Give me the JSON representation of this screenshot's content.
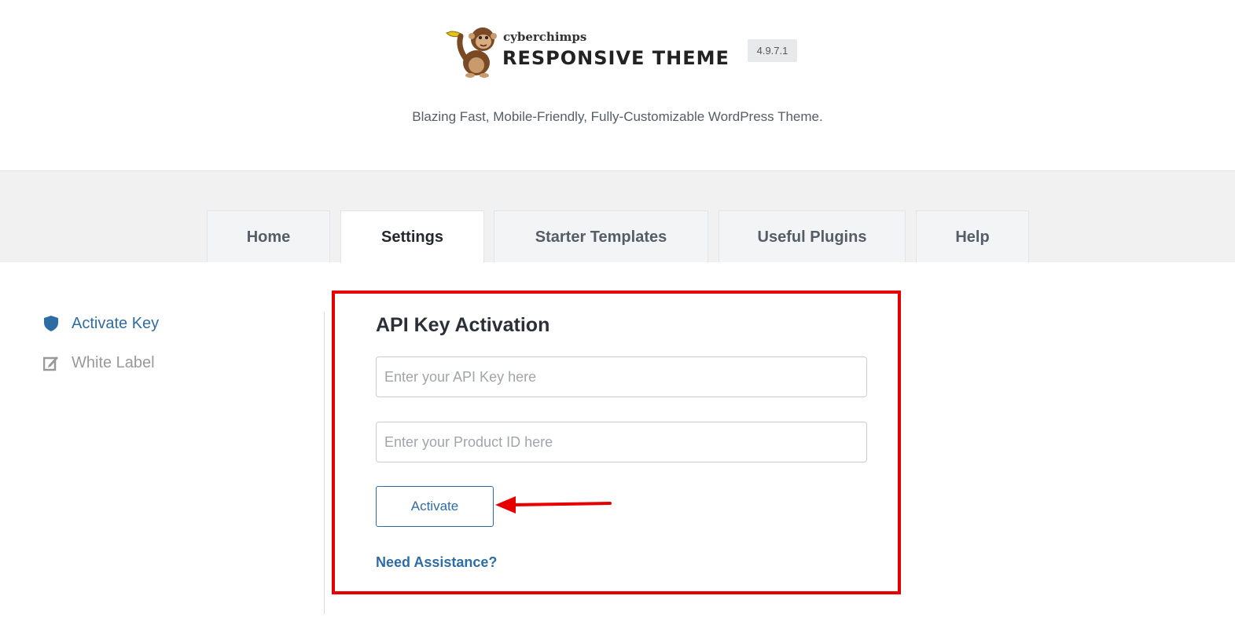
{
  "header": {
    "brand_small": "cyberchimps",
    "brand_large": "RESPONSIVE THEME",
    "version": "4.9.7.1",
    "tagline": "Blazing Fast, Mobile-Friendly, Fully-Customizable WordPress Theme."
  },
  "tabs": [
    {
      "label": "Home",
      "active": false
    },
    {
      "label": "Settings",
      "active": true
    },
    {
      "label": "Starter Templates",
      "active": false
    },
    {
      "label": "Useful Plugins",
      "active": false
    },
    {
      "label": "Help",
      "active": false
    }
  ],
  "sidebar": {
    "items": [
      {
        "label": "Activate Key",
        "icon": "shield-icon",
        "active": true
      },
      {
        "label": "White Label",
        "icon": "edit-icon",
        "active": false
      }
    ]
  },
  "panel": {
    "title": "API Key Activation",
    "api_key_placeholder": "Enter your API Key here",
    "api_key_value": "",
    "product_id_placeholder": "Enter your Product ID here",
    "product_id_value": "",
    "activate_label": "Activate",
    "assist_label": "Need Assistance?"
  },
  "colors": {
    "accent": "#2e6da4",
    "highlight": "#e60000",
    "tab_bar_bg": "#f1f1f1"
  }
}
